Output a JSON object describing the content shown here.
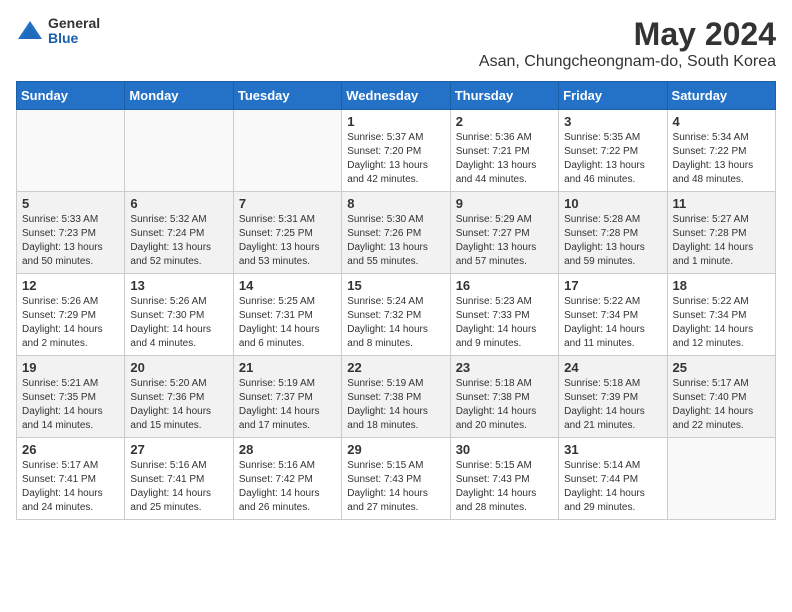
{
  "header": {
    "logo_general": "General",
    "logo_blue": "Blue",
    "title": "May 2024",
    "subtitle": "Asan, Chungcheongnam-do, South Korea"
  },
  "days_of_week": [
    "Sunday",
    "Monday",
    "Tuesday",
    "Wednesday",
    "Thursday",
    "Friday",
    "Saturday"
  ],
  "weeks": [
    [
      {
        "day": "",
        "info": ""
      },
      {
        "day": "",
        "info": ""
      },
      {
        "day": "",
        "info": ""
      },
      {
        "day": "1",
        "info": "Sunrise: 5:37 AM\nSunset: 7:20 PM\nDaylight: 13 hours\nand 42 minutes."
      },
      {
        "day": "2",
        "info": "Sunrise: 5:36 AM\nSunset: 7:21 PM\nDaylight: 13 hours\nand 44 minutes."
      },
      {
        "day": "3",
        "info": "Sunrise: 5:35 AM\nSunset: 7:22 PM\nDaylight: 13 hours\nand 46 minutes."
      },
      {
        "day": "4",
        "info": "Sunrise: 5:34 AM\nSunset: 7:22 PM\nDaylight: 13 hours\nand 48 minutes."
      }
    ],
    [
      {
        "day": "5",
        "info": "Sunrise: 5:33 AM\nSunset: 7:23 PM\nDaylight: 13 hours\nand 50 minutes."
      },
      {
        "day": "6",
        "info": "Sunrise: 5:32 AM\nSunset: 7:24 PM\nDaylight: 13 hours\nand 52 minutes."
      },
      {
        "day": "7",
        "info": "Sunrise: 5:31 AM\nSunset: 7:25 PM\nDaylight: 13 hours\nand 53 minutes."
      },
      {
        "day": "8",
        "info": "Sunrise: 5:30 AM\nSunset: 7:26 PM\nDaylight: 13 hours\nand 55 minutes."
      },
      {
        "day": "9",
        "info": "Sunrise: 5:29 AM\nSunset: 7:27 PM\nDaylight: 13 hours\nand 57 minutes."
      },
      {
        "day": "10",
        "info": "Sunrise: 5:28 AM\nSunset: 7:28 PM\nDaylight: 13 hours\nand 59 minutes."
      },
      {
        "day": "11",
        "info": "Sunrise: 5:27 AM\nSunset: 7:28 PM\nDaylight: 14 hours\nand 1 minute."
      }
    ],
    [
      {
        "day": "12",
        "info": "Sunrise: 5:26 AM\nSunset: 7:29 PM\nDaylight: 14 hours\nand 2 minutes."
      },
      {
        "day": "13",
        "info": "Sunrise: 5:26 AM\nSunset: 7:30 PM\nDaylight: 14 hours\nand 4 minutes."
      },
      {
        "day": "14",
        "info": "Sunrise: 5:25 AM\nSunset: 7:31 PM\nDaylight: 14 hours\nand 6 minutes."
      },
      {
        "day": "15",
        "info": "Sunrise: 5:24 AM\nSunset: 7:32 PM\nDaylight: 14 hours\nand 8 minutes."
      },
      {
        "day": "16",
        "info": "Sunrise: 5:23 AM\nSunset: 7:33 PM\nDaylight: 14 hours\nand 9 minutes."
      },
      {
        "day": "17",
        "info": "Sunrise: 5:22 AM\nSunset: 7:34 PM\nDaylight: 14 hours\nand 11 minutes."
      },
      {
        "day": "18",
        "info": "Sunrise: 5:22 AM\nSunset: 7:34 PM\nDaylight: 14 hours\nand 12 minutes."
      }
    ],
    [
      {
        "day": "19",
        "info": "Sunrise: 5:21 AM\nSunset: 7:35 PM\nDaylight: 14 hours\nand 14 minutes."
      },
      {
        "day": "20",
        "info": "Sunrise: 5:20 AM\nSunset: 7:36 PM\nDaylight: 14 hours\nand 15 minutes."
      },
      {
        "day": "21",
        "info": "Sunrise: 5:19 AM\nSunset: 7:37 PM\nDaylight: 14 hours\nand 17 minutes."
      },
      {
        "day": "22",
        "info": "Sunrise: 5:19 AM\nSunset: 7:38 PM\nDaylight: 14 hours\nand 18 minutes."
      },
      {
        "day": "23",
        "info": "Sunrise: 5:18 AM\nSunset: 7:38 PM\nDaylight: 14 hours\nand 20 minutes."
      },
      {
        "day": "24",
        "info": "Sunrise: 5:18 AM\nSunset: 7:39 PM\nDaylight: 14 hours\nand 21 minutes."
      },
      {
        "day": "25",
        "info": "Sunrise: 5:17 AM\nSunset: 7:40 PM\nDaylight: 14 hours\nand 22 minutes."
      }
    ],
    [
      {
        "day": "26",
        "info": "Sunrise: 5:17 AM\nSunset: 7:41 PM\nDaylight: 14 hours\nand 24 minutes."
      },
      {
        "day": "27",
        "info": "Sunrise: 5:16 AM\nSunset: 7:41 PM\nDaylight: 14 hours\nand 25 minutes."
      },
      {
        "day": "28",
        "info": "Sunrise: 5:16 AM\nSunset: 7:42 PM\nDaylight: 14 hours\nand 26 minutes."
      },
      {
        "day": "29",
        "info": "Sunrise: 5:15 AM\nSunset: 7:43 PM\nDaylight: 14 hours\nand 27 minutes."
      },
      {
        "day": "30",
        "info": "Sunrise: 5:15 AM\nSunset: 7:43 PM\nDaylight: 14 hours\nand 28 minutes."
      },
      {
        "day": "31",
        "info": "Sunrise: 5:14 AM\nSunset: 7:44 PM\nDaylight: 14 hours\nand 29 minutes."
      },
      {
        "day": "",
        "info": ""
      }
    ]
  ]
}
